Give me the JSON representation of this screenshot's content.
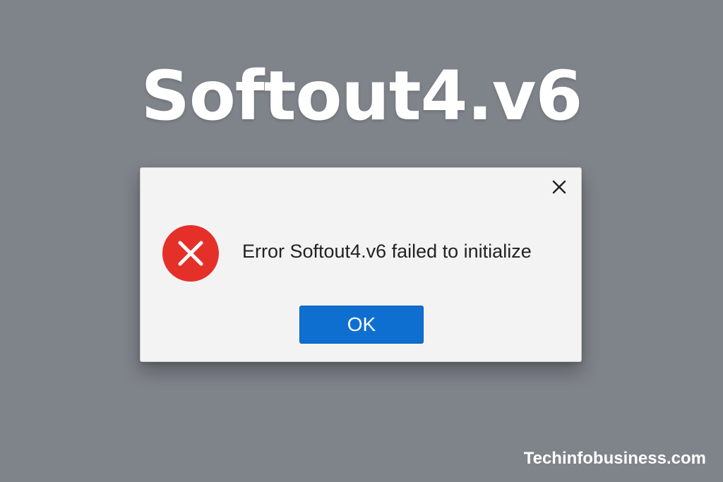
{
  "headline": "Softout4.v6",
  "dialog": {
    "message": "Error Softout4.v6 failed to initialize",
    "ok_label": "OK",
    "close_icon": "close-icon",
    "error_icon": "error-circle-x-icon",
    "error_color": "#e5302a",
    "button_color": "#0f6fd1"
  },
  "watermark": "Techinfobusiness.com"
}
